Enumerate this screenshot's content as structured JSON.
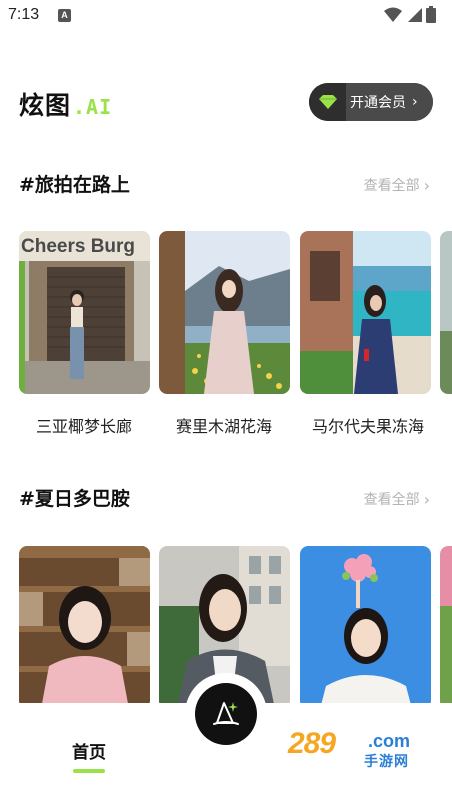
{
  "status": {
    "time": "7:13",
    "notif_letter": "A"
  },
  "header": {
    "logo_main": "炫图",
    "logo_suffix": ".AI",
    "vip_label": "开通会员"
  },
  "sections": [
    {
      "title": "#旅拍在路上",
      "see_all": "查看全部",
      "cards": [
        {
          "label": "三亚椰梦长廊",
          "sign_text": "Cheers Burg"
        },
        {
          "label": "赛里木湖花海"
        },
        {
          "label": "马尔代夫果冻海"
        }
      ]
    },
    {
      "title": "#夏日多巴胺",
      "see_all": "查看全部",
      "cards": [
        {
          "label": ""
        },
        {
          "label": ""
        },
        {
          "label": ""
        }
      ]
    }
  ],
  "bottom_nav": {
    "home_label": "首页",
    "center_icon": "wizard-hat-icon"
  },
  "watermark": {
    "number": "289",
    "domain": ".com",
    "sub": "手游网"
  },
  "colors": {
    "accent": "#9be24a",
    "vip_bg": "#3b3b3b",
    "muted": "#b3b3b3"
  }
}
